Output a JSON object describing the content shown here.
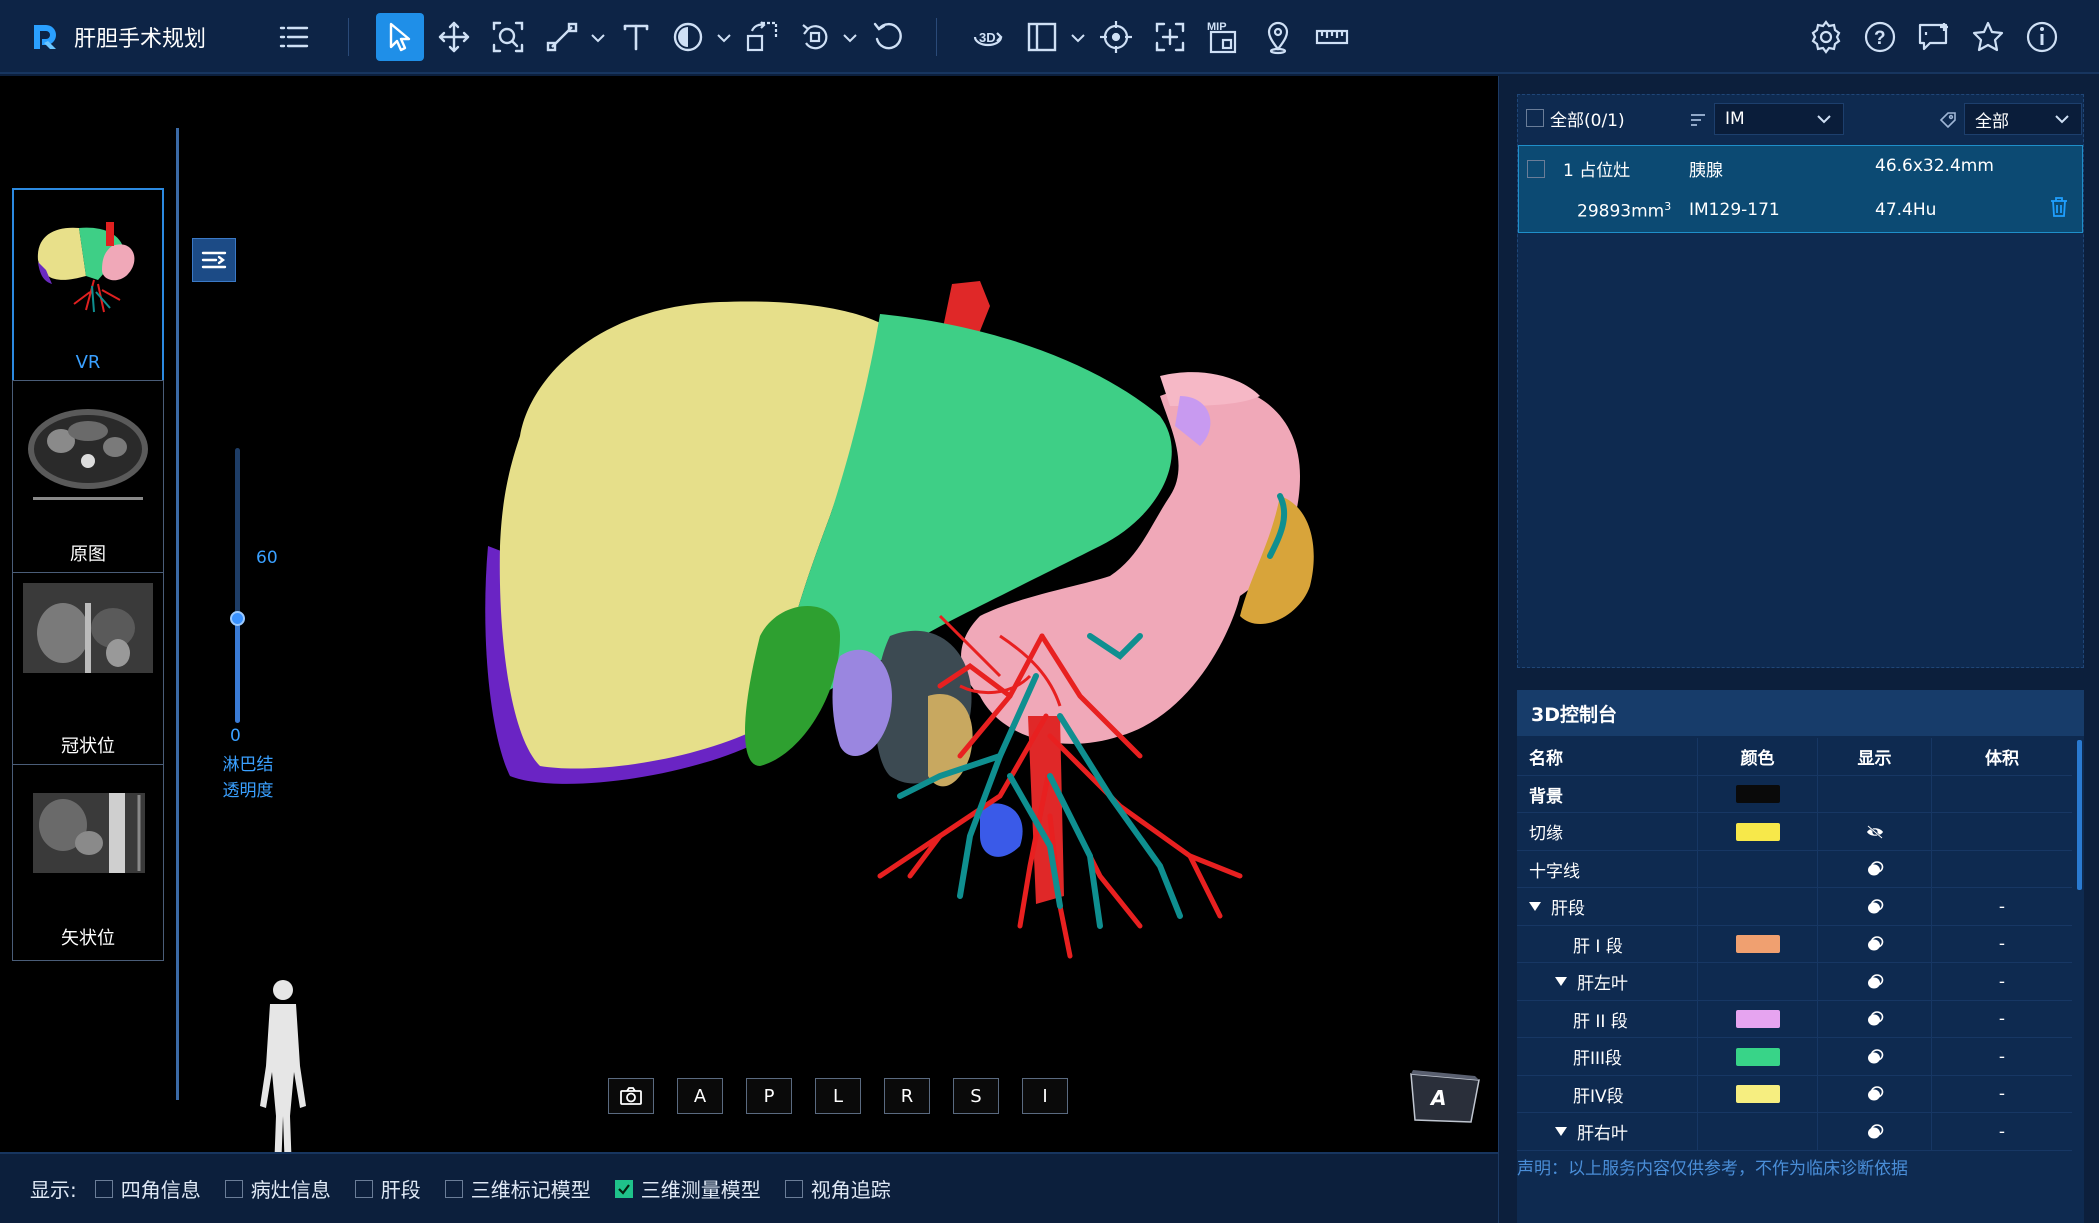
{
  "app": {
    "title": "肝胆手术规划"
  },
  "left_panel": {
    "thumbnails": [
      {
        "label": "VR",
        "active": true
      },
      {
        "label": "原图",
        "active": false
      },
      {
        "label": "冠状位",
        "active": false
      },
      {
        "label": "矢状位",
        "active": false
      }
    ]
  },
  "viewport": {
    "slider": {
      "max_label": "60",
      "min_label": "0",
      "caption_line1": "淋巴结",
      "caption_line2": "透明度",
      "value_percent": 38
    },
    "view_buttons": [
      "A",
      "P",
      "L",
      "R",
      "S",
      "I"
    ],
    "orientation": "A"
  },
  "bottom_bar": {
    "label": "显示:",
    "options": [
      {
        "label": "四角信息",
        "checked": false
      },
      {
        "label": "病灶信息",
        "checked": false
      },
      {
        "label": "肝段",
        "checked": false
      },
      {
        "label": "三维标记模型",
        "checked": false
      },
      {
        "label": "三维测量模型",
        "checked": true
      },
      {
        "label": "视角追踪",
        "checked": false
      }
    ]
  },
  "lesion_panel": {
    "all_label": "全部(0/1)",
    "sort_value": "IM",
    "filter_value": "全部",
    "lesion": {
      "index_name": "1 占位灶",
      "organ": "胰腺",
      "size": "46.6x32.4mm",
      "volume": "29893mm",
      "volume_sup": "3",
      "image_range": "IM129-171",
      "density": "47.4Hu"
    }
  },
  "control_panel": {
    "title": "3D控制台",
    "headers": {
      "name": "名称",
      "color": "颜色",
      "display": "显示",
      "volume": "体积"
    },
    "rows": [
      {
        "name": "背景",
        "color": "#0a0a0a",
        "display": "",
        "volume": "",
        "indent": 0,
        "bold": true
      },
      {
        "name": "切缘",
        "color": "#f7e84a",
        "display": "eye-off",
        "volume": "",
        "indent": 0
      },
      {
        "name": "十字线",
        "color": "",
        "display": "eye",
        "volume": "",
        "indent": 0
      },
      {
        "name": "肝段",
        "color": "",
        "display": "eye",
        "volume": "-",
        "indent": 0,
        "caret": true
      },
      {
        "name": "肝 I 段",
        "color": "#f0a070",
        "display": "eye",
        "volume": "-",
        "indent": 2
      },
      {
        "name": "肝左叶",
        "color": "",
        "display": "eye",
        "volume": "-",
        "indent": 1,
        "caret": true
      },
      {
        "name": "肝 II 段",
        "color": "#e6a4f0",
        "display": "eye",
        "volume": "-",
        "indent": 2
      },
      {
        "name": "肝III段",
        "color": "#38d488",
        "display": "eye",
        "volume": "-",
        "indent": 2
      },
      {
        "name": "肝IV段",
        "color": "#f6ee80",
        "display": "eye",
        "volume": "-",
        "indent": 2
      },
      {
        "name": "肝右叶",
        "color": "",
        "display": "eye",
        "volume": "-",
        "indent": 1,
        "caret": true
      }
    ]
  },
  "disclaimer": "声明：以上服务内容仅供参考，不作为临床诊断依据",
  "colors": {
    "accent": "#1f8fe8",
    "liver_yellow": "#e8e08a",
    "liver_green": "#3ecf86",
    "pancreas_pink": "#f0a8b8",
    "vessel_red": "#e02020",
    "vessel_teal": "#0f8f90"
  }
}
